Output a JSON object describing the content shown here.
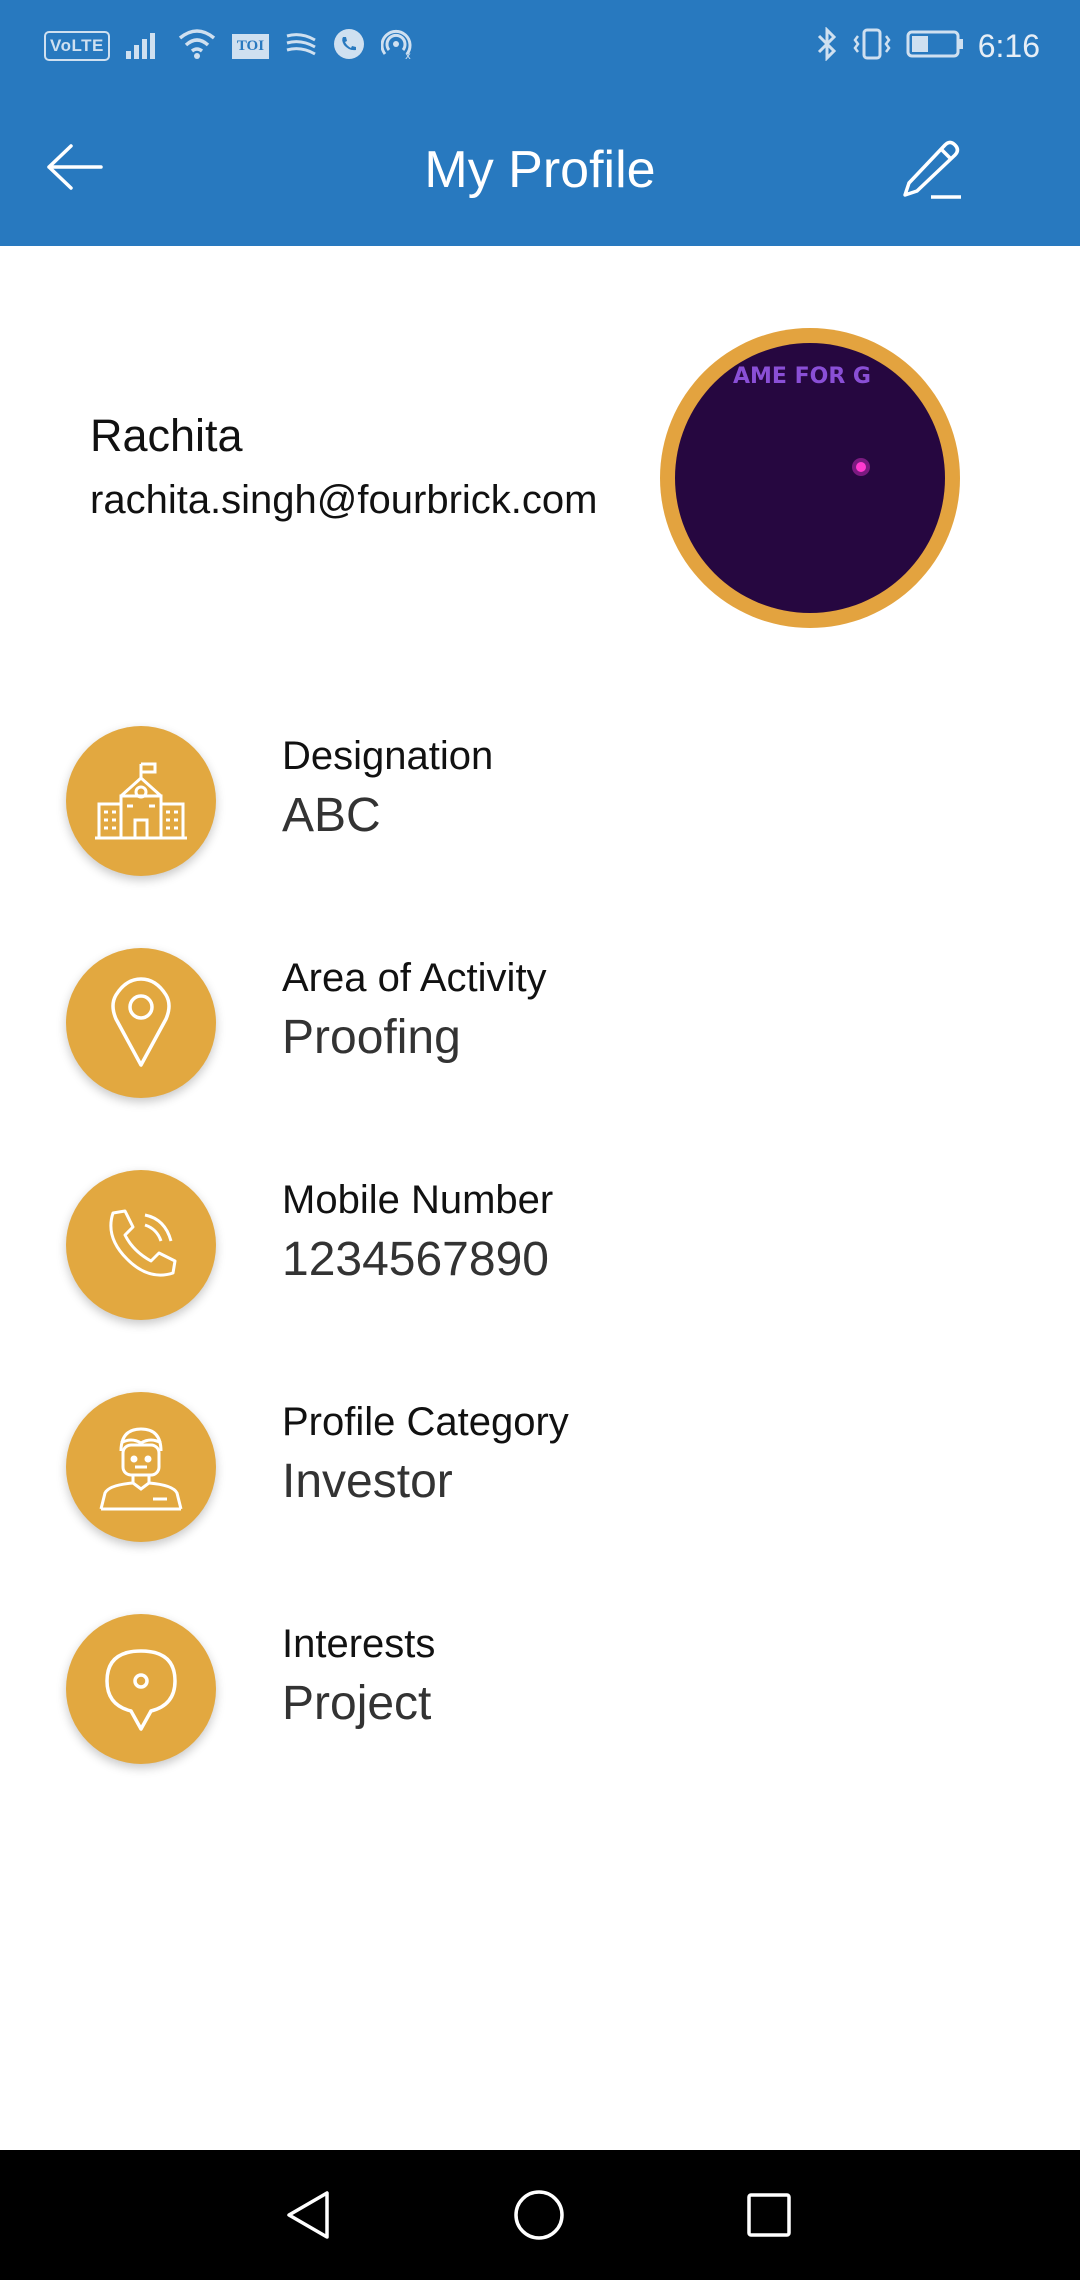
{
  "status_bar": {
    "volte": "VoLTE",
    "toi": "TOI",
    "time": "6:16"
  },
  "app_bar": {
    "title": "My Profile",
    "back_icon": "arrow-left-icon",
    "edit_icon": "pencil-icon"
  },
  "profile": {
    "name": "Rachita",
    "email": "rachita.singh@fourbrick.com",
    "avatar_text": "AME FOR G"
  },
  "rows": [
    {
      "icon": "building-icon",
      "label": "Designation",
      "value": "ABC"
    },
    {
      "icon": "location-pin-icon",
      "label": "Area of Activity",
      "value": "Proofing"
    },
    {
      "icon": "phone-icon",
      "label": "Mobile Number",
      "value": "1234567890"
    },
    {
      "icon": "person-icon",
      "label": "Profile Category",
      "value": "Investor"
    },
    {
      "icon": "map-marker-icon",
      "label": "Interests",
      "value": "Project"
    }
  ],
  "colors": {
    "primary": "#2879bf",
    "accent": "#e2a840",
    "avatar_bg": "#260740"
  }
}
